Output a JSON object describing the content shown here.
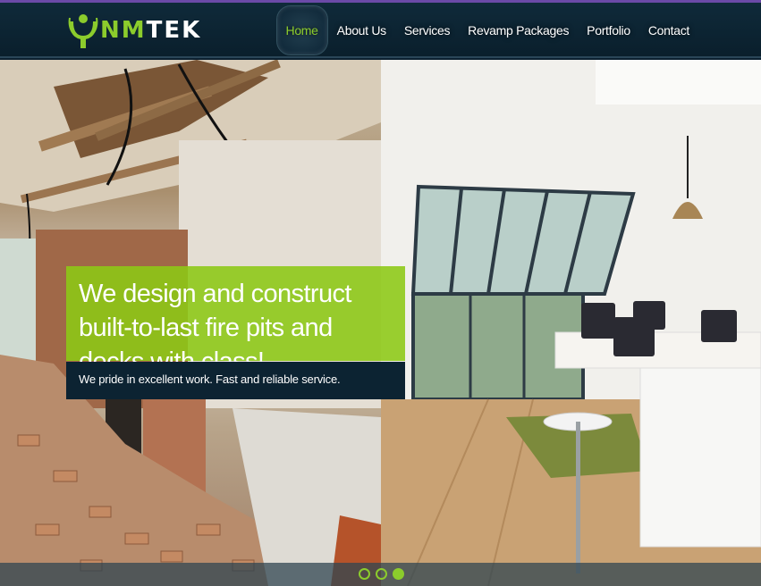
{
  "brand": {
    "name_part1": "NM",
    "name_part2": "TEK",
    "colors": {
      "accent": "#8ccc2c",
      "header": "#0b2030"
    }
  },
  "nav": {
    "items": [
      {
        "label": "Home",
        "active": true
      },
      {
        "label": "About Us"
      },
      {
        "label": "Services"
      },
      {
        "label": "Revamp Packages"
      },
      {
        "label": "Portfolio"
      },
      {
        "label": "Contact"
      }
    ]
  },
  "hero": {
    "headline": "We design and construct built-to-last fire pits and decks with class!",
    "subline": "We pride in excellent work. Fast and reliable service.",
    "slides": {
      "count": 3,
      "active_index": 2
    }
  },
  "icons": {
    "logo": "person-figure-logo-icon"
  }
}
